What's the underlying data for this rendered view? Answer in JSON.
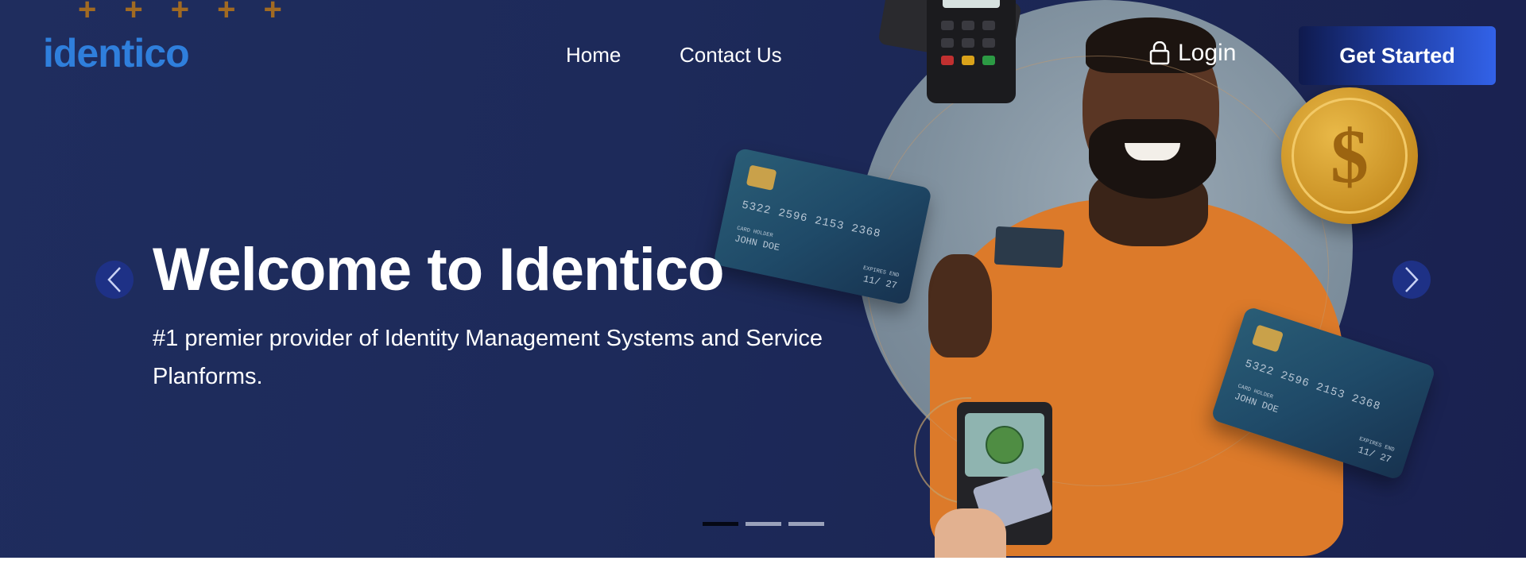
{
  "brand": {
    "logo_text": "identico"
  },
  "nav": {
    "home": "Home",
    "contact": "Contact Us"
  },
  "auth": {
    "login": "Login",
    "cta": "Get Started"
  },
  "hero": {
    "title": "Welcome to Identico",
    "subtitle": "#1 premier provider of Identity Management Systems and Service Planforms.",
    "active_slide": 1,
    "slide_count": 3
  },
  "cards": [
    {
      "number": "5322 2596 2153 2368",
      "holder_label": "CARD HOLDER",
      "holder": "JOHN DOE",
      "expiry_label": "EXPIRES END",
      "expiry": "11/ 27"
    },
    {
      "number": "5322 2596 2153 2368",
      "holder_label": "CARD HOLDER",
      "holder": "JOHN DOE",
      "expiry_label": "EXPIRES END",
      "expiry": "11/ 27"
    }
  ],
  "coin": {
    "symbol": "$"
  },
  "icons": {
    "login": "lock-icon",
    "prev": "chevron-left-icon",
    "next": "chevron-right-icon",
    "deco": "plus-icon"
  },
  "colors": {
    "background": "#1f2d5e",
    "cta_start": "#0f1a4d",
    "cta_end": "#3262e8",
    "logo": "#2f7fdc",
    "accent_plus": "#a16a22"
  }
}
